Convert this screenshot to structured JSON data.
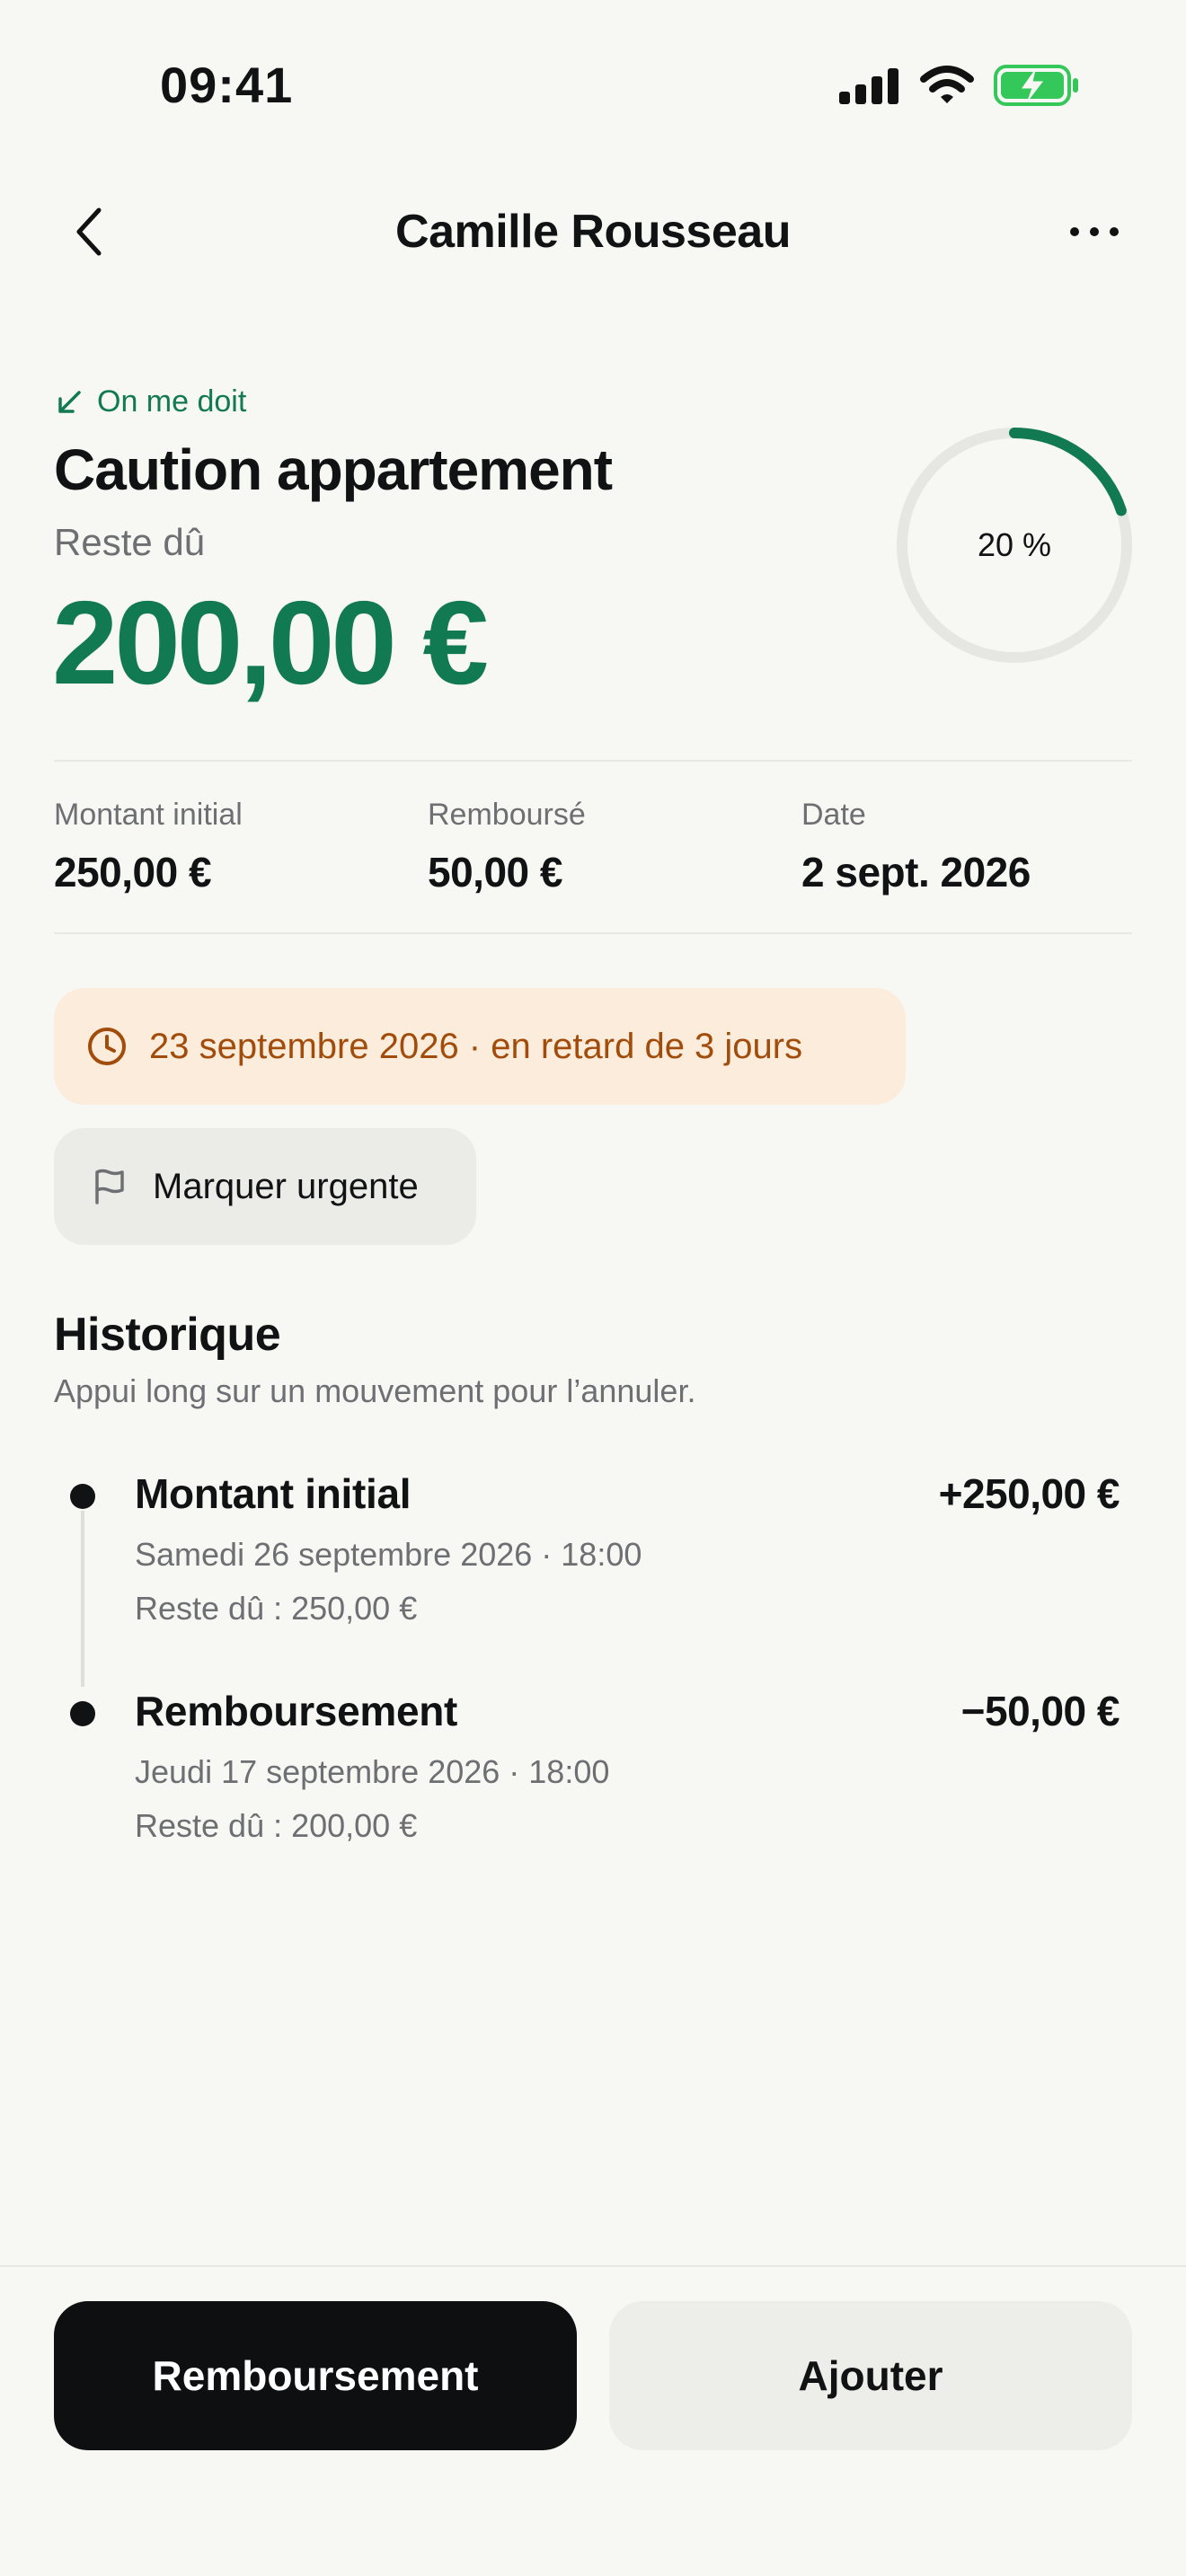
{
  "status_bar": {
    "time": "09:41",
    "icons": [
      "cellular-signal-icon",
      "wifi-icon",
      "battery-charging-icon"
    ]
  },
  "nav": {
    "back_icon": "chevron-left-icon",
    "title": "Camille Rousseau",
    "more_icon": "ellipsis-icon"
  },
  "debt": {
    "direction_label": "On me doit",
    "direction_icon": "arrow-down-left-icon",
    "title": "Caution appartement",
    "remaining_label": "Reste dû",
    "remaining_amount": "200,00 €",
    "progress_label": "20 %",
    "progress_fraction": 0.2
  },
  "stats": [
    {
      "label": "Montant initial",
      "value": "250,00 €"
    },
    {
      "label": "Remboursé",
      "value": "50,00 €"
    },
    {
      "label": "Date",
      "value": "2 sept. 2026"
    }
  ],
  "due": {
    "icon": "clock-icon",
    "text": "23 septembre 2026 · en retard de 3 jours"
  },
  "urgent": {
    "icon": "flag-icon",
    "label": "Marquer urgente"
  },
  "history": {
    "title": "Historique",
    "subtitle": "Appui long sur un mouvement pour l’annuler.",
    "entries": [
      {
        "title": "Montant initial",
        "amount": "+250,00 €",
        "datetime": "Samedi 26 septembre 2026 · 18:00",
        "remaining": "Reste dû : 250,00 €"
      },
      {
        "title": "Remboursement",
        "amount": "−50,00 €",
        "datetime": "Jeudi 17 septembre 2026 · 18:00",
        "remaining": "Reste dû : 200,00 €"
      }
    ]
  },
  "actions": {
    "primary_label": "Remboursement",
    "secondary_label": "Ajouter"
  },
  "colors": {
    "accent_green": "#127a52",
    "warning_bg": "#fcecdc",
    "warning_text": "#a24c0b",
    "battery_green": "#34c759"
  }
}
